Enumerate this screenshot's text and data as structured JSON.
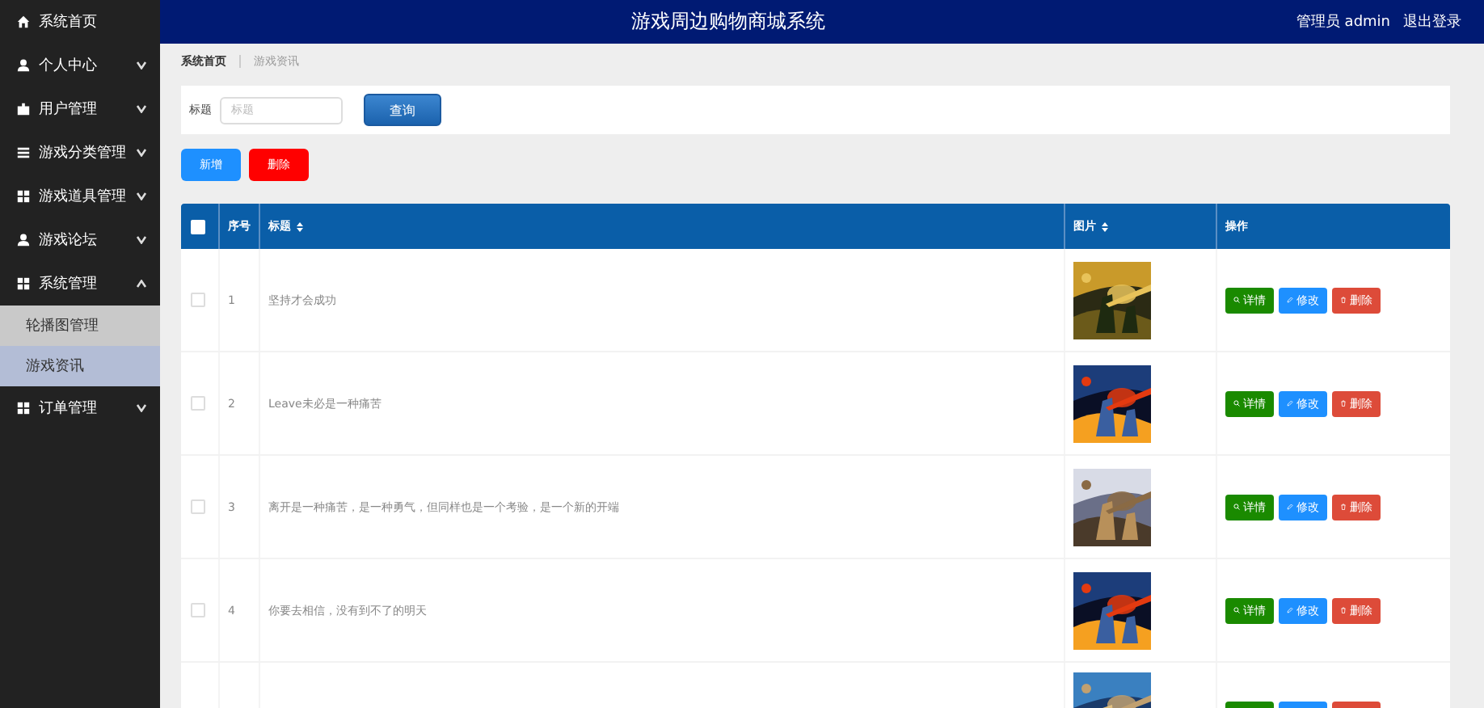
{
  "header": {
    "title": "游戏周边购物商城系统",
    "user": "管理员 admin",
    "logout": "退出登录"
  },
  "sidebar": {
    "items": [
      {
        "label": "系统首页",
        "kind": "link"
      },
      {
        "label": "个人中心",
        "kind": "menu",
        "expanded": false
      },
      {
        "label": "用户管理",
        "kind": "menu",
        "expanded": false
      },
      {
        "label": "游戏分类管理",
        "kind": "menu",
        "expanded": false
      },
      {
        "label": "游戏道具管理",
        "kind": "menu",
        "expanded": false
      },
      {
        "label": "游戏论坛",
        "kind": "menu",
        "expanded": false
      },
      {
        "label": "系统管理",
        "kind": "menu",
        "expanded": true,
        "children": [
          {
            "label": "轮播图管理",
            "selected": false
          },
          {
            "label": "游戏资讯",
            "selected": true
          }
        ]
      },
      {
        "label": "订单管理",
        "kind": "menu",
        "expanded": false
      }
    ]
  },
  "breadcrumb": [
    "系统首页",
    "游戏资讯"
  ],
  "search": {
    "label": "标题",
    "placeholder": "标题",
    "button": "查询"
  },
  "actions": [
    {
      "label": "新增",
      "kind": "add"
    },
    {
      "label": "删除",
      "kind": "delete"
    }
  ],
  "table": {
    "select_all": {
      "checked": false
    },
    "columns": [
      {
        "label": "序号",
        "sortable": false
      },
      {
        "label": "标题",
        "sortable": true
      },
      {
        "label": "图片",
        "sortable": true
      },
      {
        "label": "操作",
        "sortable": false
      }
    ],
    "rows": [
      {
        "checked": false,
        "index": "1",
        "title": "坚持才会成功",
        "picture": {
          "kind": "picture"
        },
        "actions": [
          {
            "kind": "detail",
            "label": "详情"
          },
          {
            "kind": "edit",
            "label": "修改"
          },
          {
            "kind": "delete",
            "label": "删除"
          }
        ]
      },
      {
        "checked": false,
        "index": "2",
        "title": "Leave未必是一种痛苦",
        "picture": {
          "kind": "picture"
        },
        "actions": [
          {
            "kind": "detail",
            "label": "详情"
          },
          {
            "kind": "edit",
            "label": "修改"
          },
          {
            "kind": "delete",
            "label": "删除"
          }
        ]
      },
      {
        "checked": false,
        "index": "3",
        "title": "离开是一种痛苦，是一种勇气，但同样也是一个考验，是一个新的开端",
        "picture": {
          "kind": "picture"
        },
        "actions": [
          {
            "kind": "detail",
            "label": "详情"
          },
          {
            "kind": "edit",
            "label": "修改"
          },
          {
            "kind": "delete",
            "label": "删除"
          }
        ]
      },
      {
        "checked": false,
        "index": "4",
        "title": "你要去相信，没有到不了的明天",
        "picture": {
          "kind": "picture"
        },
        "actions": [
          {
            "kind": "detail",
            "label": "详情"
          },
          {
            "kind": "edit",
            "label": "修改"
          },
          {
            "kind": "delete",
            "label": "删除"
          }
        ]
      }
    ],
    "clipped_row": {
      "picture": {
        "kind": "picture"
      },
      "actions": [
        {
          "kind": "detail"
        },
        {
          "kind": "edit"
        },
        {
          "kind": "delete"
        }
      ]
    }
  }
}
